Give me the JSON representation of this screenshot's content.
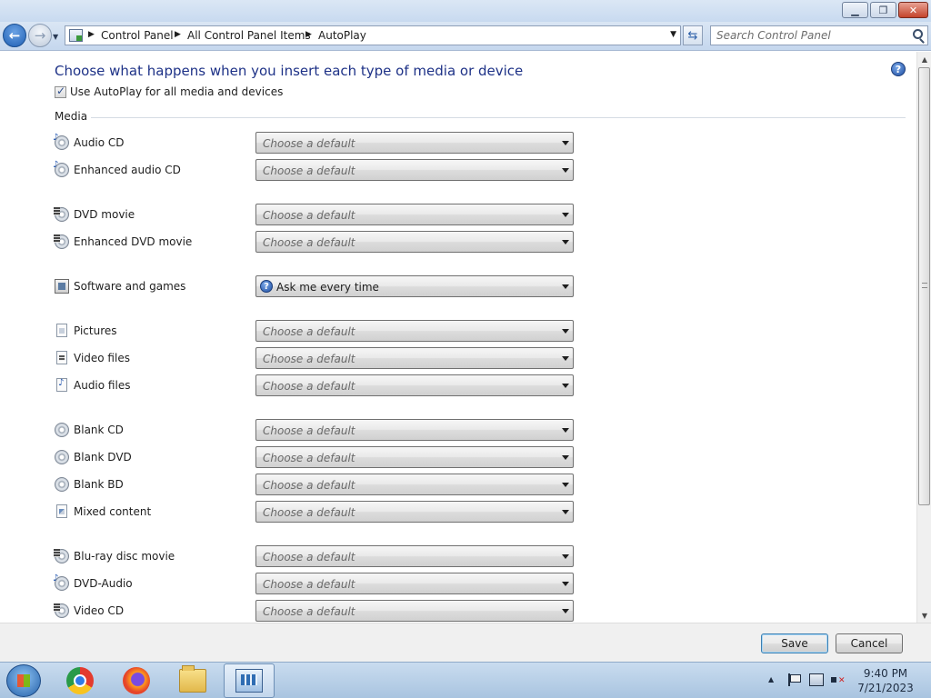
{
  "window": {
    "min_glyph": "▁",
    "max_glyph": "❐",
    "close_glyph": "✕"
  },
  "address_bar": {
    "breadcrumbs": [
      "Control Panel",
      "All Control Panel Items",
      "AutoPlay"
    ],
    "search_placeholder": "Search Control Panel"
  },
  "page": {
    "heading": "Choose what happens when you insert each type of media or device",
    "autoplay_checkbox_label": "Use AutoPlay for all media and devices",
    "autoplay_checked": true,
    "section_title": "Media",
    "default_choice": "Choose a default",
    "media_items": [
      {
        "label": "Audio CD",
        "icon": "cd-music-icon",
        "value": "Choose a default"
      },
      {
        "label": "Enhanced audio CD",
        "icon": "cd-music-icon",
        "value": "Choose a default"
      },
      {
        "label": "DVD movie",
        "icon": "dvd-icon",
        "value": "Choose a default"
      },
      {
        "label": "Enhanced DVD movie",
        "icon": "dvd-icon",
        "value": "Choose a default"
      },
      {
        "label": "Software and games",
        "icon": "software-icon",
        "value": "Ask me every time"
      },
      {
        "label": "Pictures",
        "icon": "pictures-file-icon",
        "value": "Choose a default"
      },
      {
        "label": "Video files",
        "icon": "video-file-icon",
        "value": "Choose a default"
      },
      {
        "label": "Audio files",
        "icon": "audio-file-icon",
        "value": "Choose a default"
      },
      {
        "label": "Blank CD",
        "icon": "blank-cd-icon",
        "value": "Choose a default"
      },
      {
        "label": "Blank DVD",
        "icon": "blank-dvd-icon",
        "value": "Choose a default"
      },
      {
        "label": "Blank BD",
        "icon": "blank-bd-icon",
        "value": "Choose a default"
      },
      {
        "label": "Mixed content",
        "icon": "mixed-content-icon",
        "value": "Choose a default"
      },
      {
        "label": "Blu-ray disc movie",
        "icon": "bluray-icon",
        "value": "Choose a default"
      },
      {
        "label": "DVD-Audio",
        "icon": "cd-music-icon",
        "value": "Choose a default"
      },
      {
        "label": "Video CD",
        "icon": "dvd-icon",
        "value": "Choose a default"
      }
    ]
  },
  "footer": {
    "save_label": "Save",
    "cancel_label": "Cancel"
  },
  "taskbar": {
    "apps": [
      "Google Chrome",
      "Mozilla Firefox",
      "Windows Explorer",
      "Control Panel"
    ],
    "time": "9:40 PM",
    "date": "7/21/2023"
  }
}
